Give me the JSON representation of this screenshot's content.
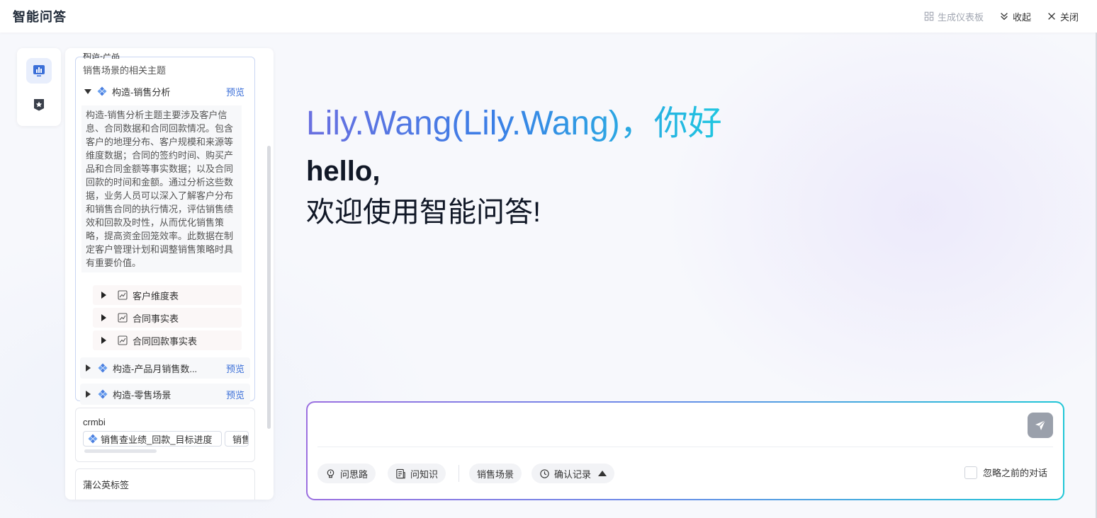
{
  "header": {
    "title": "智能问答",
    "generate_dashboard": "生成仪表板",
    "collapse": "收起",
    "close": "关闭"
  },
  "panel": {
    "group1": {
      "cut_label": "构造-产品",
      "subtitle": "销售场景的相关主题",
      "topics": [
        {
          "name": "构造-销售分析",
          "preview": "预览"
        },
        {
          "name": "构造-产品月销售数...",
          "preview": "预览"
        },
        {
          "name": "构造-零售场景",
          "preview": "预览"
        }
      ],
      "description": "构造-销售分析主题主要涉及客户信息、合同数据和合同回款情况。包含客户的地理分布、客户规模和来源等维度数据；合同的签约时间、购买产品和合同金额等事实数据；以及合同回款的时间和金额。通过分析这些数据，业务人员可以深入了解客户分布和销售合同的执行情况，评估销售绩效和回款及时性，从而优化销售策略，提高资金回笼效率。此数据在制定客户管理计划和调整销售策略时具有重要价值。",
      "tables": [
        "客户维度表",
        "合同事实表",
        "合同回款事实表"
      ]
    },
    "group2": {
      "name": "crmbi",
      "chips": [
        "销售查业绩_回款_目标进度",
        "销售"
      ]
    },
    "group3": {
      "name": "蒲公英标签"
    }
  },
  "greeting": {
    "name_line": "Lily.Wang(Lily.Wang)，你好",
    "hello": "hello,",
    "welcome": "欢迎使用智能问答!"
  },
  "input": {
    "placeholder": "",
    "tools": {
      "ideas": "问思路",
      "knowledge": "问知识",
      "scene": "销售场景",
      "records": "确认记录"
    },
    "ignore_history": "忽略之前的对话"
  }
}
